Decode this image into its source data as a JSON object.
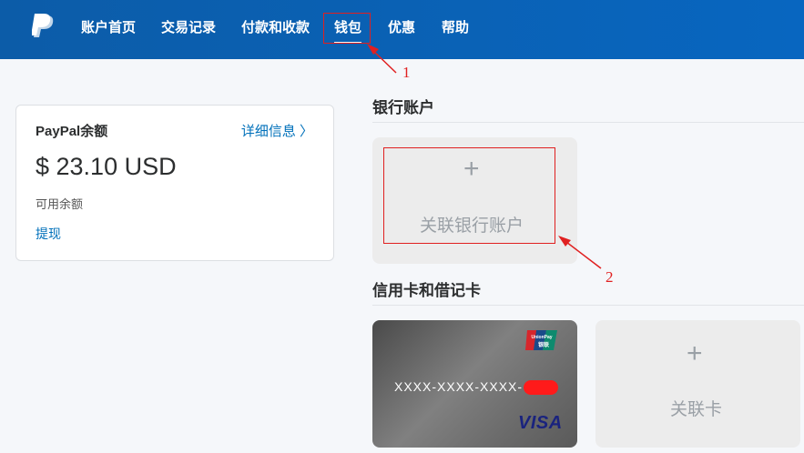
{
  "nav": {
    "items": [
      "账户首页",
      "交易记录",
      "付款和收款",
      "钱包",
      "优惠",
      "帮助"
    ],
    "active": "钱包"
  },
  "annotations": [
    "1",
    "2"
  ],
  "balance": {
    "title": "PayPal余额",
    "detail_link": "详细信息 〉",
    "amount": "$ 23.10 USD",
    "sub_label": "可用余额",
    "withdraw": "提现"
  },
  "bank": {
    "title": "银行账户",
    "add_label": "关联银行账户"
  },
  "cards": {
    "title": "信用卡和借记卡",
    "card_number": "XXXX-XXXX-XXXX-",
    "card_brand": "VISA",
    "unionpay_text": "UnionPay 银联",
    "add_label": "关联卡"
  },
  "colors": {
    "header": "#0866c0",
    "link": "#0070ba",
    "annotation": "#e02020"
  }
}
